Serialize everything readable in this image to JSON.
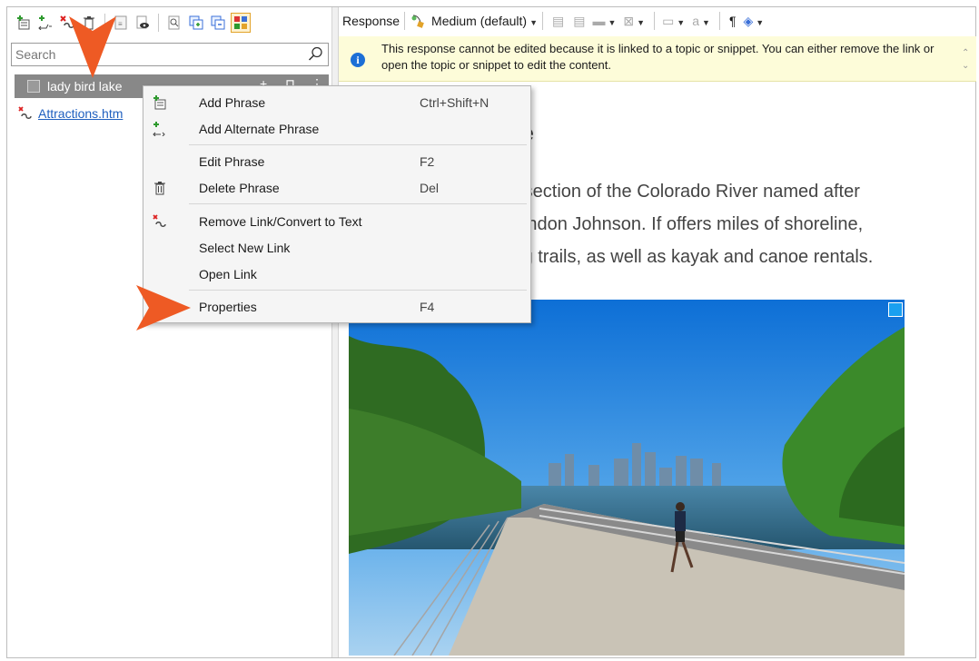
{
  "left_toolbar": {
    "icons": [
      "add-phrase-icon",
      "add-alternate-phrase-icon",
      "remove-link-icon",
      "delete-icon",
      "edit-text-icon",
      "preview-icon",
      "find-icon",
      "copy-icon",
      "paste-icon",
      "grid-view-icon"
    ]
  },
  "search": {
    "placeholder": "Search",
    "value": ""
  },
  "phrase": {
    "label": "lady bird lake"
  },
  "link": {
    "label": "Attractions.htm"
  },
  "right_toolbar": {
    "response_label": "Response",
    "medium_label": "Medium (default)"
  },
  "info_bar": {
    "message": "This response cannot be edited because it is linked to a topic or snippet. You can either remove the link or open the topic or snippet to edit the content."
  },
  "content": {
    "heading_fragment": "ke",
    "para_lines": [
      "a section of the Colorado River named after",
      "Lyndon Johnson. If offers miles of shoreline,",
      "ing trails, as well as kayak and canoe rentals."
    ]
  },
  "context_menu": {
    "items": [
      {
        "label": "Add Phrase",
        "shortcut": "Ctrl+Shift+N",
        "icon": "add-phrase-icon"
      },
      {
        "label": "Add Alternate Phrase",
        "shortcut": "",
        "icon": "add-alternate-phrase-icon"
      },
      {
        "label": "Edit Phrase",
        "shortcut": "F2",
        "icon": ""
      },
      {
        "label": "Delete Phrase",
        "shortcut": "Del",
        "icon": "delete-icon"
      },
      {
        "label": "Remove Link/Convert to Text",
        "shortcut": "",
        "icon": "remove-link-icon"
      },
      {
        "label": "Select New Link",
        "shortcut": "",
        "icon": ""
      },
      {
        "label": "Open Link",
        "shortcut": "",
        "icon": ""
      },
      {
        "label": "Properties",
        "shortcut": "F4",
        "icon": ""
      }
    ]
  },
  "colors": {
    "highlight_arrow": "#ee5a24",
    "selected_row": "#888888",
    "info_bar": "#fdfcd9",
    "link": "#1f5fbf"
  }
}
